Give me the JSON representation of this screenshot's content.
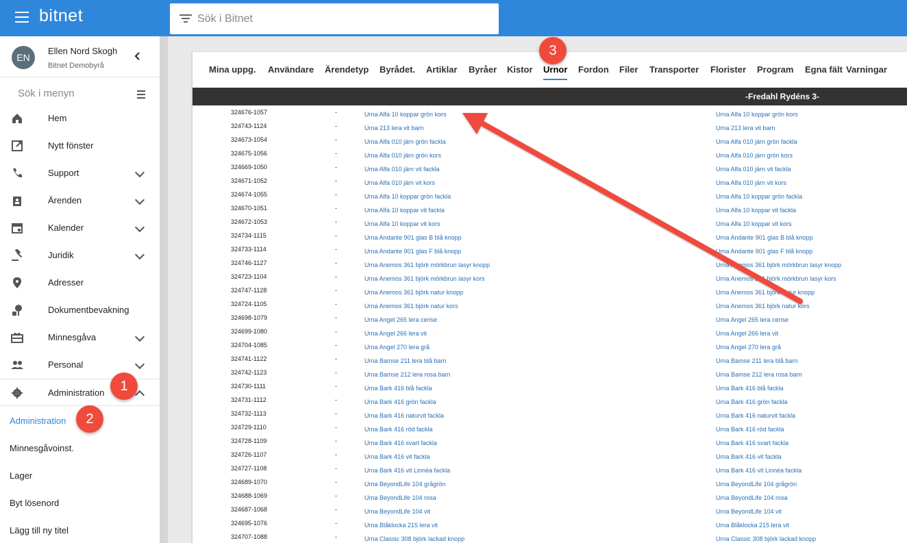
{
  "app": {
    "brand": "bitnet"
  },
  "search": {
    "placeholder": "Sök i Bitnet"
  },
  "user": {
    "initials": "EN",
    "name": "Ellen Nord Skogh",
    "org": "Bitnet Demobyrå"
  },
  "menu_search": {
    "placeholder": "Sök i menyn"
  },
  "nav": [
    {
      "label": "Hem",
      "icon": "home-icon",
      "chevron": false
    },
    {
      "label": "Nytt fönster",
      "icon": "open-in-new-icon",
      "chevron": false
    },
    {
      "label": "Support",
      "icon": "phone-icon",
      "chevron": true
    },
    {
      "label": "Ärenden",
      "icon": "clipboard-user-icon",
      "chevron": true
    },
    {
      "label": "Kalender",
      "icon": "calendar-icon",
      "chevron": true
    },
    {
      "label": "Juridik",
      "icon": "gavel-icon",
      "chevron": true
    },
    {
      "label": "Adresser",
      "icon": "location-pin-icon",
      "chevron": false
    },
    {
      "label": "Dokumentbevakning",
      "icon": "document-watch-icon",
      "chevron": false
    },
    {
      "label": "Minnesgåva",
      "icon": "gift-card-icon",
      "chevron": true
    },
    {
      "label": "Personal",
      "icon": "people-icon",
      "chevron": true
    },
    {
      "label": "Administration",
      "icon": "gear-icon",
      "chevron": true,
      "expanded": true
    }
  ],
  "subnav": [
    {
      "label": "Administration",
      "active": true
    },
    {
      "label": "Minnesgåvoinst.",
      "active": false
    },
    {
      "label": "Lager",
      "active": false
    },
    {
      "label": "Byt lösenord",
      "active": false
    },
    {
      "label": "Lägg till ny titel",
      "active": false
    }
  ],
  "tabs": [
    {
      "label": "Mina uppg."
    },
    {
      "label": "Användare"
    },
    {
      "label": "Ärendetyp"
    },
    {
      "label": "Byrådet."
    },
    {
      "label": "Artiklar"
    },
    {
      "label": "Byråer"
    },
    {
      "label": "Kistor"
    },
    {
      "label": "Urnor",
      "active": true
    },
    {
      "label": "Fordon"
    },
    {
      "label": "Filer"
    },
    {
      "label": "Transporter"
    },
    {
      "label": "Florister"
    },
    {
      "label": "Program"
    },
    {
      "label": "Egna fält"
    },
    {
      "label": "Varningar"
    }
  ],
  "group_header": "-Fredahl Rydéns 3-",
  "rows": [
    {
      "num": "324676-1057",
      "dash": "-",
      "name1": "Urna Alfa 10 koppar grön kors",
      "name2": "Urna Alfa 10 koppar grön kors"
    },
    {
      "num": "324743-1124",
      "dash": "-",
      "name1": "Urna 213 lera vit barn",
      "name2": "Urna 213 lera vit barn"
    },
    {
      "num": "324673-1054",
      "dash": "-",
      "name1": "Urna Alfa 010 järn grön fackla",
      "name2": "Urna Alfa 010 järn grön fackla"
    },
    {
      "num": "324675-1056",
      "dash": "-",
      "name1": "Urna Alfa 010 järn grön kors",
      "name2": "Urna Alfa 010 järn grön kors"
    },
    {
      "num": "324669-1050",
      "dash": "-",
      "name1": "Urna Alfa 010 järn vit fackla",
      "name2": "Urna Alfa 010 järn vit fackla"
    },
    {
      "num": "324671-1052",
      "dash": "-",
      "name1": "Urna Alfa 010 järn vit kors",
      "name2": "Urna Alfa 010 järn vit kors"
    },
    {
      "num": "324674-1055",
      "dash": "-",
      "name1": "Urna Alfa 10 koppar grön fackla",
      "name2": "Urna Alfa 10 koppar grön fackla"
    },
    {
      "num": "324670-1051",
      "dash": "-",
      "name1": "Urna Alfa 10 koppar vit fackla",
      "name2": "Urna Alfa 10 koppar vit fackla"
    },
    {
      "num": "324672-1053",
      "dash": "-",
      "name1": "Urna Alfa 10 koppar vit kors",
      "name2": "Urna Alfa 10 koppar vit kors"
    },
    {
      "num": "324734-1115",
      "dash": "-",
      "name1": "Urna Andante 901 glas B blå knopp",
      "name2": "Urna Andante 901 glas B blå knopp"
    },
    {
      "num": "324733-1114",
      "dash": "-",
      "name1": "Urna Andante 901 glas F blå knopp",
      "name2": "Urna Andante 901 glas F blå knopp"
    },
    {
      "num": "324746-1127",
      "dash": "-",
      "name1": "Urna Anemos 361 björk mörkbrun lasyr knopp",
      "name2": "Urna Anemos 361 björk mörkbrun lasyr knopp"
    },
    {
      "num": "324723-1104",
      "dash": "-",
      "name1": "Urna Anemos 361 björk mörkbrun lasyr kors",
      "name2": "Urna Anemos 361 björk mörkbrun lasyr kors"
    },
    {
      "num": "324747-1128",
      "dash": "-",
      "name1": "Urna Anemos 361 björk natur knopp",
      "name2": "Urna Anemos 361 björk natur knopp"
    },
    {
      "num": "324724-1105",
      "dash": "-",
      "name1": "Urna Anemos 361 björk natur kors",
      "name2": "Urna Anemos 361 björk natur kors"
    },
    {
      "num": "324698-1079",
      "dash": "-",
      "name1": "Urna Angel 265 lera cerise",
      "name2": "Urna Angel 265 lera cerise"
    },
    {
      "num": "324699-1080",
      "dash": "-",
      "name1": "Urna Angel 266 lera vit",
      "name2": "Urna Angel 266 lera vit"
    },
    {
      "num": "324704-1085",
      "dash": "-",
      "name1": "Urna Angel 270 lera grå",
      "name2": "Urna Angel 270 lera grå"
    },
    {
      "num": "324741-1122",
      "dash": "-",
      "name1": "Urna Bamse 211 lera blå barn",
      "name2": "Urna Bamse 211 lera blå barn"
    },
    {
      "num": "324742-1123",
      "dash": "-",
      "name1": "Urna Bamse 212 lera rosa barn",
      "name2": "Urna Bamse 212 lera rosa barn"
    },
    {
      "num": "324730-1111",
      "dash": "-",
      "name1": "Urna Bark 416 blå fackla",
      "name2": "Urna Bark 416 blå fackla"
    },
    {
      "num": "324731-1112",
      "dash": "-",
      "name1": "Urna Bark 416 grön fackla",
      "name2": "Urna Bark 416 grön fackla"
    },
    {
      "num": "324732-1113",
      "dash": "-",
      "name1": "Urna Bark 416 naturvit fackla",
      "name2": "Urna Bark 416 naturvit fackla"
    },
    {
      "num": "324729-1110",
      "dash": "-",
      "name1": "Urna Bark 416 röd fackla",
      "name2": "Urna Bark 416 röd fackla"
    },
    {
      "num": "324728-1109",
      "dash": "-",
      "name1": "Urna Bark 416 svart fackla",
      "name2": "Urna Bark 416 svart fackla"
    },
    {
      "num": "324726-1107",
      "dash": "-",
      "name1": "Urna Bark 416 vit fackla",
      "name2": "Urna Bark 416 vit fackla"
    },
    {
      "num": "324727-1108",
      "dash": "-",
      "name1": "Urna Bark 416 vit Linnéa fackla",
      "name2": "Urna Bark 416 vit Linnéa fackla"
    },
    {
      "num": "324689-1070",
      "dash": "-",
      "name1": "Urna BeyondLife 104 grågrön",
      "name2": "Urna BeyondLife 104 grågrön"
    },
    {
      "num": "324688-1069",
      "dash": "-",
      "name1": "Urna BeyondLife 104 rosa",
      "name2": "Urna BeyondLife 104 rosa"
    },
    {
      "num": "324687-1068",
      "dash": "-",
      "name1": "Urna BeyondLife 104 vit",
      "name2": "Urna BeyondLife 104 vit"
    },
    {
      "num": "324695-1076",
      "dash": "-",
      "name1": "Urna Blåklocka 215 lera vit",
      "name2": "Urna Blåklocka 215 lera vit"
    },
    {
      "num": "324707-1088",
      "dash": "-",
      "name1": "Urna Classic 308 björk lackad knopp",
      "name2": "Urna Classic 308 björk lackad knopp"
    }
  ],
  "annotations": [
    {
      "label": "1"
    },
    {
      "label": "2"
    },
    {
      "label": "3"
    }
  ],
  "colors": {
    "topbar": "#2f87db",
    "link": "#2a6fb5",
    "badge": "#f04a3d",
    "header": "#333333"
  }
}
